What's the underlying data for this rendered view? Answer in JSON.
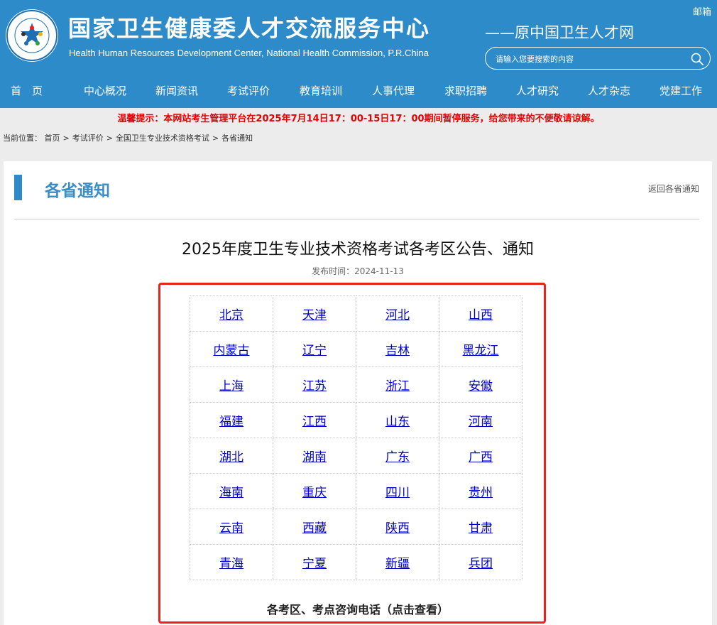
{
  "header": {
    "title": "国家卫生健康委人才交流服务中心",
    "subtitle_en": "Health Human Resources Development Center, National Health Commission, P.R.China",
    "slogan": "——原中国卫生人才网",
    "mail_label": "邮箱",
    "search_placeholder": "请输入您要搜索的内容",
    "brand_color": "#2e8bc9"
  },
  "nav": {
    "items": [
      {
        "label": "首　页"
      },
      {
        "label": "中心概况"
      },
      {
        "label": "新闻资讯"
      },
      {
        "label": "考试评价"
      },
      {
        "label": "教育培训"
      },
      {
        "label": "人事代理"
      },
      {
        "label": "求职招聘"
      },
      {
        "label": "人才研究"
      },
      {
        "label": "人才杂志"
      },
      {
        "label": "党建工作"
      }
    ]
  },
  "notice": "温馨提示：本网站考生管理平台在2025年7月14日17：00-15日17：00期间暂停服务，给您带来的不便敬请谅解。",
  "breadcrumb": {
    "prefix": "当前位置：",
    "items": [
      "首页",
      "考试评价",
      "全国卫生专业技术资格考试",
      "各省通知"
    ]
  },
  "section": {
    "title": "各省通知",
    "back_label": "返回各省通知"
  },
  "article": {
    "title": "2025年度卫生专业技术资格考试各考区公告、通知",
    "date": "发布时间：2024-11-13",
    "provinces": [
      [
        "北京",
        "天津",
        "河北",
        "山西"
      ],
      [
        "内蒙古",
        "辽宁",
        "吉林",
        "黑龙江"
      ],
      [
        "上海",
        "江苏",
        "浙江",
        "安徽"
      ],
      [
        "福建",
        "江西",
        "山东",
        "河南"
      ],
      [
        "湖北",
        "湖南",
        "广东",
        "广西"
      ],
      [
        "海南",
        "重庆",
        "四川",
        "贵州"
      ],
      [
        "云南",
        "西藏",
        "陕西",
        "甘肃"
      ],
      [
        "青海",
        "宁夏",
        "新疆",
        "兵团"
      ]
    ],
    "hotline_label": "各考区、考点咨询电话（点击查看）"
  },
  "icons": {
    "logo": "center-logo-icon",
    "search": "search-icon"
  }
}
